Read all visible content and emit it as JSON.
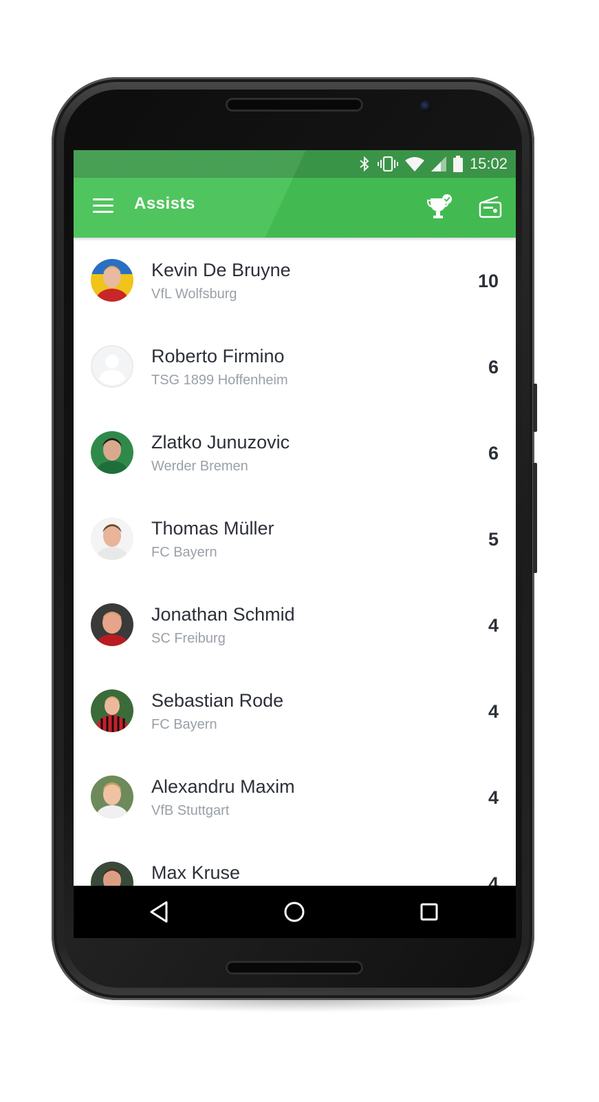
{
  "status_bar": {
    "time": "15:02"
  },
  "app_bar": {
    "title": "Assists"
  },
  "players": [
    {
      "name": "Kevin De Bruyne",
      "team": "VfL Wolfsburg",
      "assists": "10",
      "avatar": "photo"
    },
    {
      "name": "Roberto Firmino",
      "team": "TSG 1899 Hoffenheim",
      "assists": "6",
      "avatar": "placeholder"
    },
    {
      "name": "Zlatko Junuzovic",
      "team": "Werder Bremen",
      "assists": "6",
      "avatar": "photo"
    },
    {
      "name": "Thomas Müller",
      "team": "FC Bayern",
      "assists": "5",
      "avatar": "photo"
    },
    {
      "name": "Jonathan Schmid",
      "team": "SC Freiburg",
      "assists": "4",
      "avatar": "photo"
    },
    {
      "name": "Sebastian Rode",
      "team": "FC Bayern",
      "assists": "4",
      "avatar": "photo"
    },
    {
      "name": "Alexandru Maxim",
      "team": "VfB Stuttgart",
      "assists": "4",
      "avatar": "photo"
    },
    {
      "name": "Max Kruse",
      "team": "",
      "assists": "4",
      "avatar": "photo"
    }
  ],
  "colors": {
    "primary": "#45c154",
    "status_bar": "#3c9a4a",
    "text_primary": "#2c3038",
    "text_secondary": "#9aa0a8"
  },
  "icons": {
    "menu": "hamburger-icon",
    "trophy": "trophy-check-icon",
    "radio": "radio-icon",
    "back": "back-triangle-icon",
    "home": "home-circle-icon",
    "recents": "recents-square-icon",
    "bluetooth": "bluetooth-icon",
    "vibrate": "vibrate-icon",
    "wifi": "wifi-icon",
    "signal": "signal-icon",
    "battery": "battery-icon"
  }
}
